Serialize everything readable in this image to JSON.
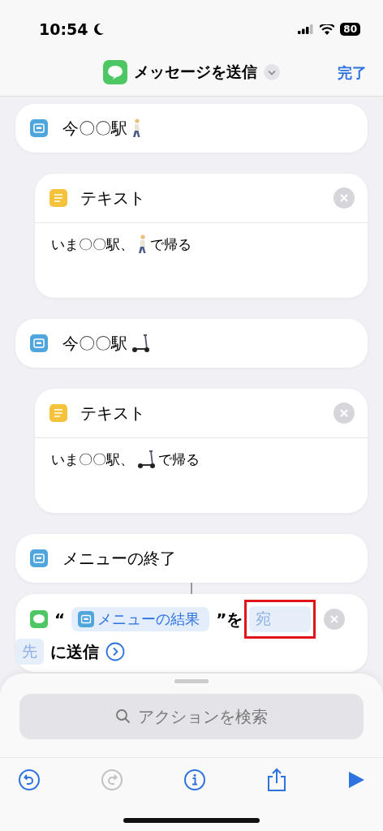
{
  "status_bar": {
    "time": "10:54",
    "battery": "80"
  },
  "nav": {
    "title": "メッセージを送信",
    "done": "完了"
  },
  "blocks": [
    {
      "kind": "menu",
      "label": "今〇〇駅",
      "emoji": {
        "kind": "walk"
      }
    },
    {
      "kind": "text",
      "title": "テキスト",
      "body": "いま〇〇駅、",
      "body_after": "で帰る",
      "emoji": {
        "kind": "walk"
      }
    },
    {
      "kind": "menu",
      "label": "今〇〇駅",
      "emoji": {
        "kind": "scooter"
      }
    },
    {
      "kind": "text",
      "title": "テキスト",
      "body": "いま〇〇駅、",
      "body_after": "で帰る",
      "emoji": {
        "kind": "scooter"
      }
    },
    {
      "kind": "menu",
      "label": "メニューの終了"
    }
  ],
  "send_action": {
    "open_quote": "“",
    "variable": "メニューの結果",
    "close_quote": "”を",
    "recipient": [
      "宛",
      "先"
    ],
    "highlighted": true,
    "suffix": "に送信"
  },
  "search": {
    "placeholder": "アクションを検索"
  },
  "toolbar": [
    {
      "kind": "undo",
      "disabled": false
    },
    {
      "kind": "redo",
      "disabled": true
    },
    {
      "kind": "info",
      "disabled": false
    },
    {
      "kind": "share",
      "disabled": false
    },
    {
      "kind": "play",
      "disabled": false
    }
  ]
}
